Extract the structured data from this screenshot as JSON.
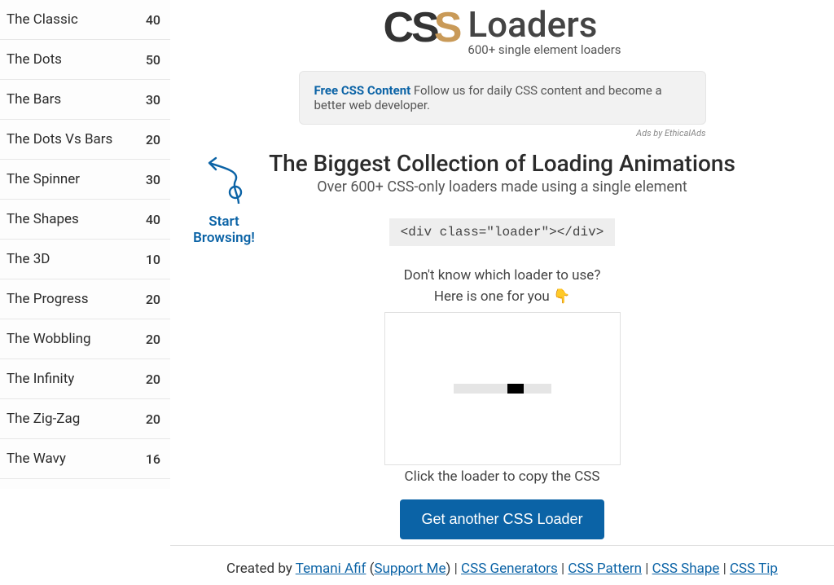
{
  "logo": {
    "css": "CSS",
    "loaders": "Loaders",
    "subtitle": "600+ single element loaders"
  },
  "sidebar_items": [
    {
      "name": "The Classic",
      "count": "40"
    },
    {
      "name": "The Dots",
      "count": "50"
    },
    {
      "name": "The Bars",
      "count": "30"
    },
    {
      "name": "The Dots Vs Bars",
      "count": "20"
    },
    {
      "name": "The Spinner",
      "count": "30"
    },
    {
      "name": "The Shapes",
      "count": "40"
    },
    {
      "name": "The 3D",
      "count": "10"
    },
    {
      "name": "The Progress",
      "count": "20"
    },
    {
      "name": "The Wobbling",
      "count": "20"
    },
    {
      "name": "The Infinity",
      "count": "20"
    },
    {
      "name": "The Zig-Zag",
      "count": "20"
    },
    {
      "name": "The Wavy",
      "count": "16"
    }
  ],
  "ad": {
    "bold": "Free CSS Content",
    "text": " Follow us for daily CSS content and become a better web developer."
  },
  "ads_by": "Ads by EthicalAds",
  "headline": "The Biggest Collection of Loading Animations",
  "subhead": "Over 600+ CSS-only loaders made using a single element",
  "code": "<div class=\"loader\"></div>",
  "dontknow_line1": "Don't know which loader to use?",
  "dontknow_line2": "Here is one for you ",
  "emoji": "👇",
  "clickmsg": "Click the loader to copy the CSS",
  "button": "Get another CSS Loader",
  "hint_line1": "Start",
  "hint_line2": "Browsing!",
  "footer": {
    "created": "Created by ",
    "author": "Temani Afif",
    "support_open": " (",
    "support": "Support Me",
    "support_close": ") ",
    "links": [
      "CSS Generators",
      "CSS Pattern",
      "CSS Shape",
      "CSS Tip"
    ]
  }
}
